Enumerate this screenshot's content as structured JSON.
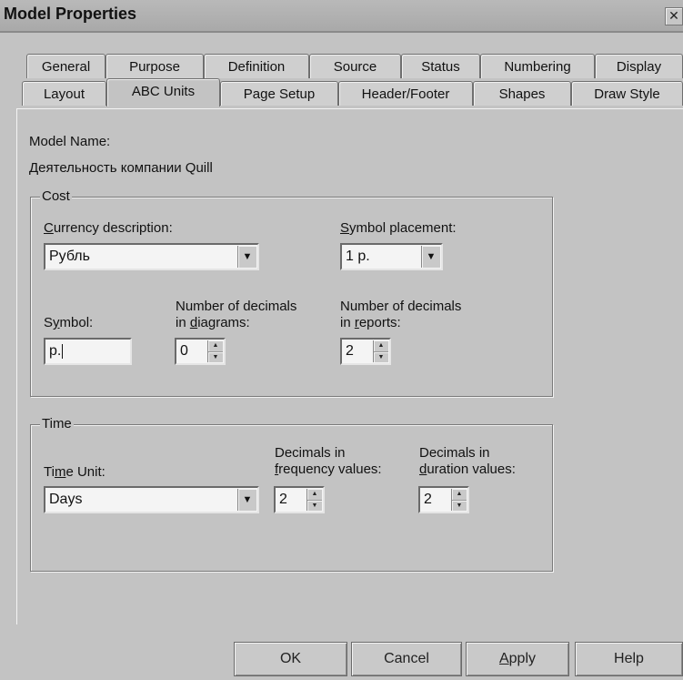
{
  "window": {
    "title": "Model Properties",
    "close_label": "✕"
  },
  "tabs_row1": [
    "General",
    "Purpose",
    "Definition",
    "Source",
    "Status",
    "Numbering",
    "Display"
  ],
  "tabs_row2": [
    "Layout",
    "ABC Units",
    "Page Setup",
    "Header/Footer",
    "Shapes",
    "Draw Style"
  ],
  "active_tab": "ABC Units",
  "model": {
    "name_label": "Model Name:",
    "name_value": "Деятельность компании Quill"
  },
  "cost": {
    "title": "Cost",
    "currency_label": "Currency description:",
    "currency_value": "Рубль",
    "placement_label": "Symbol placement:",
    "placement_value": "1 р.",
    "symbol_label": "Symbol:",
    "symbol_value": "p.",
    "diagram_decimals_label_1": "Number of decimals",
    "diagram_decimals_label_2": "in diagrams:",
    "diagram_decimals_value": "0",
    "report_decimals_label_1": "Number of decimals",
    "report_decimals_label_2": "in reports:",
    "report_decimals_value": "2"
  },
  "time": {
    "title": "Time",
    "unit_label": "Time Unit:",
    "unit_value": "Days",
    "freq_label_1": "Decimals in",
    "freq_label_2": "frequency values:",
    "freq_value": "2",
    "dur_label_1": "Decimals in",
    "dur_label_2": "duration values:",
    "dur_value": "2"
  },
  "buttons": {
    "ok": "OK",
    "cancel": "Cancel",
    "apply": "Apply",
    "help": "Help"
  },
  "icons": {
    "dropdown": "▼",
    "spin_up": "▲",
    "spin_down": "▼"
  }
}
